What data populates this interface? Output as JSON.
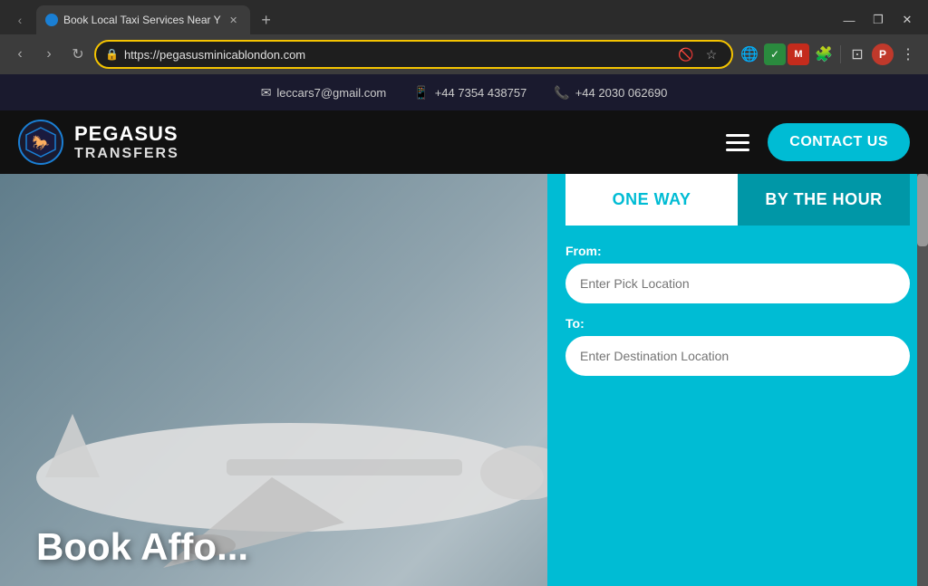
{
  "browser": {
    "tab": {
      "title": "Book Local Taxi Services Near Y",
      "favicon_color": "#1a7fd4",
      "url": "https://pegasusminicablondon.com"
    },
    "new_tab_label": "+",
    "window_controls": {
      "minimize": "—",
      "maximize": "❐",
      "close": "✕"
    },
    "nav": {
      "back": "‹",
      "forward": "›",
      "reload": "↻"
    }
  },
  "infobar": {
    "email_icon": "✉",
    "email": "leccars7@gmail.com",
    "phone1_icon": "📱",
    "phone1": "+44 7354 438757",
    "phone2_icon": "📞",
    "phone2": "+44 2030 062690"
  },
  "navbar": {
    "logo_icon": "🐎",
    "logo_line1": "PEGASUS",
    "logo_line2": "TRANSFERS",
    "hamburger_lines": 3,
    "contact_button": "CONTACT US"
  },
  "hero": {
    "bottom_text": "Book Affo..."
  },
  "booking": {
    "tab_one_way": "ONE WAY",
    "tab_by_hour": "BY THE HOUR",
    "from_label": "From:",
    "from_placeholder": "Enter Pick Location",
    "to_label": "To:",
    "to_placeholder": "Enter Destination Location"
  }
}
